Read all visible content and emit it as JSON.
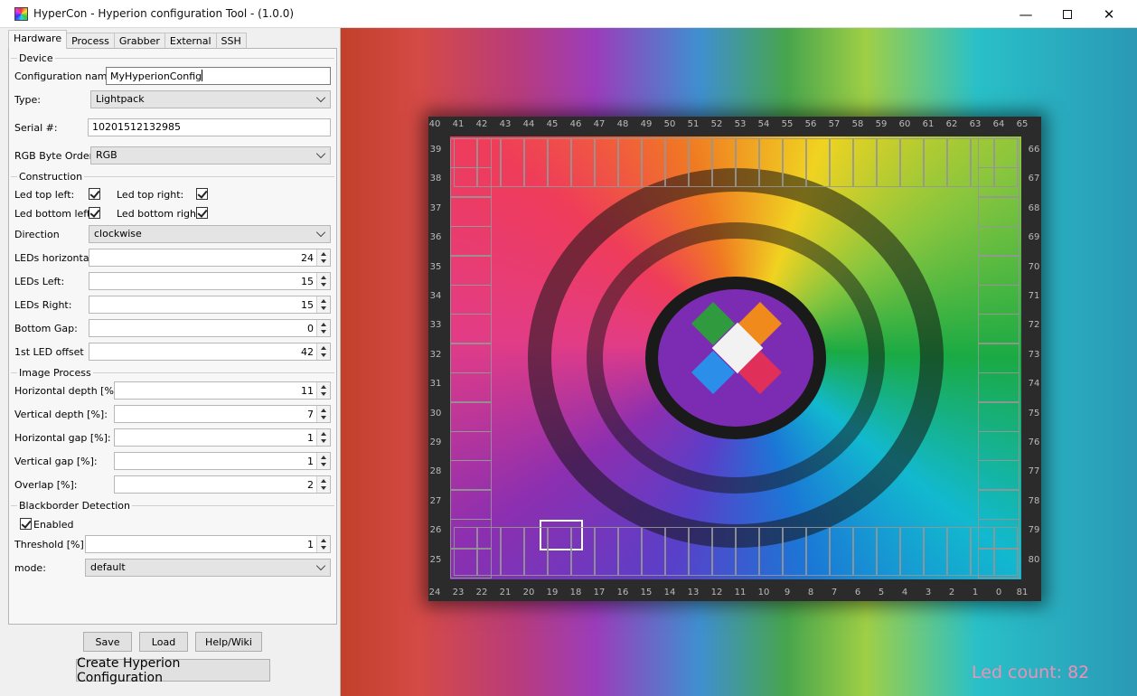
{
  "window": {
    "title": "HyperCon - Hyperion configuration Tool - (1.0.0)",
    "min_glyph": "—",
    "close_glyph": "✕"
  },
  "tabs": [
    "Hardware",
    "Process",
    "Grabber",
    "External",
    "SSH"
  ],
  "device": {
    "section": "Device",
    "config_name_label": "Configuration name:",
    "config_name_value": "MyHyperionConfig",
    "type_label": "Type:",
    "type_value": "Lightpack",
    "serial_label": "Serial #:",
    "serial_value": "10201512132985",
    "rgb_label": "RGB Byte Order:",
    "rgb_value": "RGB"
  },
  "construction": {
    "section": "Construction",
    "led_top_left": "Led top left:",
    "led_top_right": "Led top right:",
    "led_bottom_left": "Led bottom left:",
    "led_bottom_right": "Led bottom right:",
    "direction_label": "Direction",
    "direction_value": "clockwise",
    "leds_horizontal_label": "LEDs horizontal:",
    "leds_horizontal": "24",
    "leds_left_label": "LEDs Left:",
    "leds_left": "15",
    "leds_right_label": "LEDs Right:",
    "leds_right": "15",
    "bottom_gap_label": "Bottom Gap:",
    "bottom_gap": "0",
    "offset_label": "1st LED offset",
    "offset": "42"
  },
  "image_process": {
    "section": "Image Process",
    "hdepth_label": "Horizontal depth [%]:",
    "hdepth": "11",
    "vdepth_label": "Vertical depth [%]:",
    "vdepth": "7",
    "hgap_label": "Horizontal gap [%]:",
    "hgap": "1",
    "vgap_label": "Vertical gap [%]:",
    "vgap": "1",
    "overlap_label": "Overlap [%]:",
    "overlap": "2"
  },
  "blackborder": {
    "section": "Blackborder Detection",
    "enabled_label": "Enabled",
    "threshold_label": "Threshold [%]:",
    "threshold": "1",
    "mode_label": "mode:",
    "mode_value": "default"
  },
  "buttons": {
    "save": "Save",
    "load": "Load",
    "help": "Help/Wiki",
    "create": "Create Hyperion Configuration"
  },
  "preview": {
    "led_count": "Led count: 82",
    "top_numbers": [
      "40",
      "41",
      "42",
      "43",
      "44",
      "45",
      "46",
      "47",
      "48",
      "49",
      "50",
      "51",
      "52",
      "53",
      "54",
      "55",
      "56",
      "57",
      "58",
      "59",
      "60",
      "61",
      "62",
      "63",
      "64",
      "65"
    ],
    "bottom_numbers": [
      "24",
      "23",
      "22",
      "21",
      "20",
      "19",
      "18",
      "17",
      "16",
      "15",
      "14",
      "13",
      "12",
      "11",
      "10",
      "9",
      "8",
      "7",
      "6",
      "5",
      "4",
      "3",
      "2",
      "1",
      "0",
      "81"
    ],
    "left_numbers": [
      "39",
      "38",
      "37",
      "36",
      "35",
      "34",
      "33",
      "32",
      "31",
      "30",
      "29",
      "28",
      "27",
      "26",
      "25"
    ],
    "right_numbers": [
      "66",
      "67",
      "68",
      "69",
      "70",
      "71",
      "72",
      "73",
      "74",
      "75",
      "76",
      "77",
      "78",
      "79",
      "80"
    ]
  }
}
